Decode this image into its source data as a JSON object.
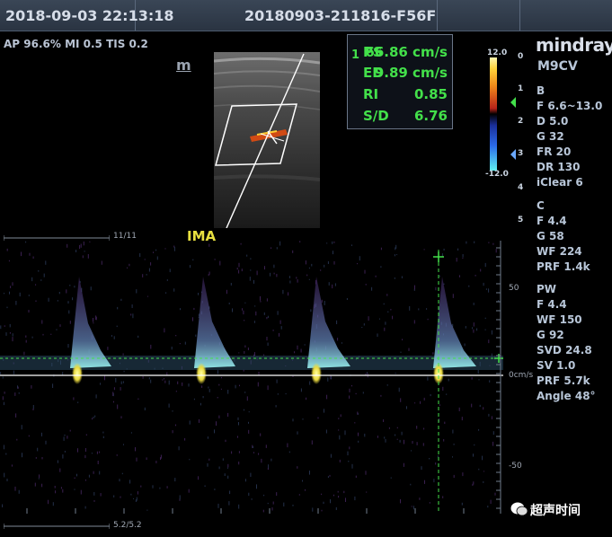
{
  "header": {
    "date": "2018-09-03 22:13:18",
    "patient_id": "20180903-211816-F56F"
  },
  "system_info": "AP 96.6%  MI 0.5  TIS 0.2",
  "orientation_marker": "m",
  "measurements": {
    "index": "1",
    "rows": [
      {
        "label": "PS",
        "value": "66.86 cm/s"
      },
      {
        "label": "ED",
        "value": "9.89 cm/s"
      },
      {
        "label": "RI",
        "value": "0.85"
      },
      {
        "label": "S/D",
        "value": "6.76"
      }
    ]
  },
  "color_bar": {
    "top": "12.0",
    "bottom": "-12.0",
    "depth_ticks": [
      "0",
      "1",
      "2",
      "3",
      "4",
      "5"
    ]
  },
  "brand": {
    "logo": "mindray",
    "probe": "M9CV"
  },
  "params": {
    "b_head": "B",
    "b": [
      "F 6.6~13.0",
      "D 5.0",
      "G 32",
      "FR 20",
      "DR 130",
      "iClear 6"
    ],
    "c_head": "C",
    "c": [
      "F 4.4",
      "G 58",
      "WF 224",
      "PRF 1.4k"
    ],
    "pw_head": "PW",
    "pw": [
      "F 4.4",
      "WF 150",
      "G 92",
      "SVD 24.8",
      "SV 1.0",
      "PRF 5.7k",
      "Angle 48°"
    ]
  },
  "spectral": {
    "label": "IMA",
    "top_page": "11/11",
    "bottom_page": "5.2/5.2",
    "velocity_ticks": [
      "50",
      "0cm/s",
      "-50"
    ]
  },
  "watermark": {
    "text": "超声时间"
  },
  "colors": {
    "measure_green": "#43e04a",
    "label_yellow": "#e8e040",
    "baseline": "#ffffff"
  }
}
